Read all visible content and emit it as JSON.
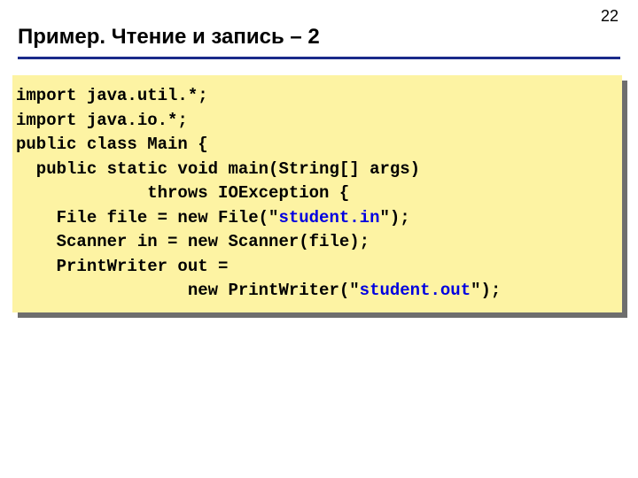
{
  "page_number": "22",
  "title": "Пример. Чтение и запись – 2",
  "code": {
    "l1": "import java.util.*;",
    "l2": "import java.io.*;",
    "l3": "public class Main {",
    "l4": "  public static void main(String[] args)",
    "l5": "             throws IOException {",
    "l6a": "    File file = new File(\"",
    "l6b": "student.in",
    "l6c": "\");",
    "l7": "    Scanner in = new Scanner(file);",
    "l8": "    PrintWriter out =",
    "l9a": "                 new PrintWriter(\"",
    "l9b": "student.out",
    "l9c": "\");"
  }
}
